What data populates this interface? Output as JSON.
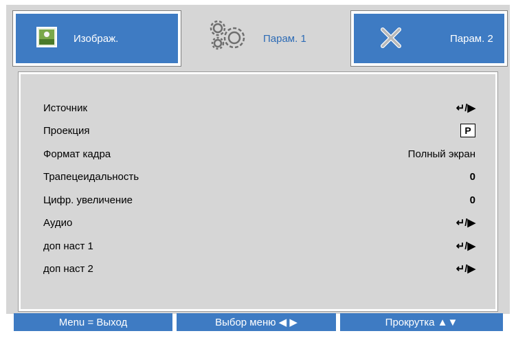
{
  "tabs": [
    {
      "label": "Изображ.",
      "icon": "image-settings-icon",
      "active": false
    },
    {
      "label": "Парам. 1",
      "icon": "gears-icon",
      "active": true
    },
    {
      "label": "Парам. 2",
      "icon": "tools-icon",
      "active": false
    }
  ],
  "menu": {
    "items": [
      {
        "label": "Источник",
        "value": "↵/▶",
        "value_type": "enter-icon"
      },
      {
        "label": "Проекция",
        "value": "P",
        "value_type": "projection-icon"
      },
      {
        "label": "Формат кадра",
        "value": "Полный экран",
        "value_type": "text"
      },
      {
        "label": "Трапецеидальность",
        "value": "0",
        "value_type": "text"
      },
      {
        "label": "Цифр. увеличение",
        "value": "0",
        "value_type": "text"
      },
      {
        "label": "Аудио",
        "value": "↵/▶",
        "value_type": "enter-icon"
      },
      {
        "label": "доп наст 1",
        "value": "↵/▶",
        "value_type": "enter-icon"
      },
      {
        "label": "доп наст 2",
        "value": "↵/▶",
        "value_type": "enter-icon"
      }
    ]
  },
  "bottom_bar": {
    "exit": "Menu = Выход",
    "select": "Выбор меню ◀ ▶",
    "scroll": "Прокрутка ▲▼"
  },
  "colors": {
    "tab_blue": "#3e7bc3",
    "panel_gray": "#d6d6d6",
    "active_text": "#2d6bb5"
  }
}
